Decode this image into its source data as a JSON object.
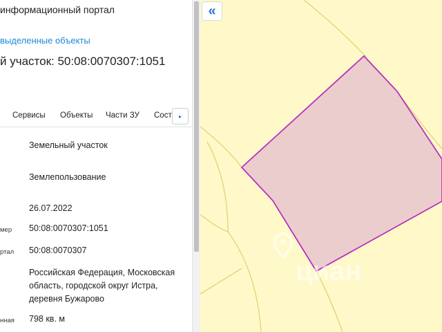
{
  "header": {
    "portal_title": "информационный портал",
    "selected_objects_link": "выделенные объекты",
    "parcel_heading": "й участок: 50:08:0070307:1051"
  },
  "tabs": [
    {
      "label": "Сервисы"
    },
    {
      "label": "Объекты"
    },
    {
      "label": "Части ЗУ"
    },
    {
      "label": "Соста"
    }
  ],
  "tab_next_glyph": "▸",
  "details": [
    {
      "label": "",
      "value": "Земельный участок"
    },
    {
      "label": "",
      "value": "Землепользование"
    },
    {
      "label": "",
      "value": "26.07.2022"
    },
    {
      "label": "мер",
      "value": "50:08:0070307:1051"
    },
    {
      "label": "ртал",
      "value": "50:08:0070307"
    },
    {
      "label": "",
      "value": "Российская Федерация, Московская область, городской округ Истра, деревня Бужарово"
    },
    {
      "label": "нная",
      "value": "798 кв. м"
    }
  ],
  "map": {
    "collapse_glyph": "«",
    "watermark": "циан",
    "watermark_icon": "location-pin-icon",
    "colors": {
      "background": "#fff9c9",
      "parcel_fill": "#ebcdcd",
      "parcel_stroke": "#b92fbf",
      "lines": "#e3d57a"
    }
  }
}
